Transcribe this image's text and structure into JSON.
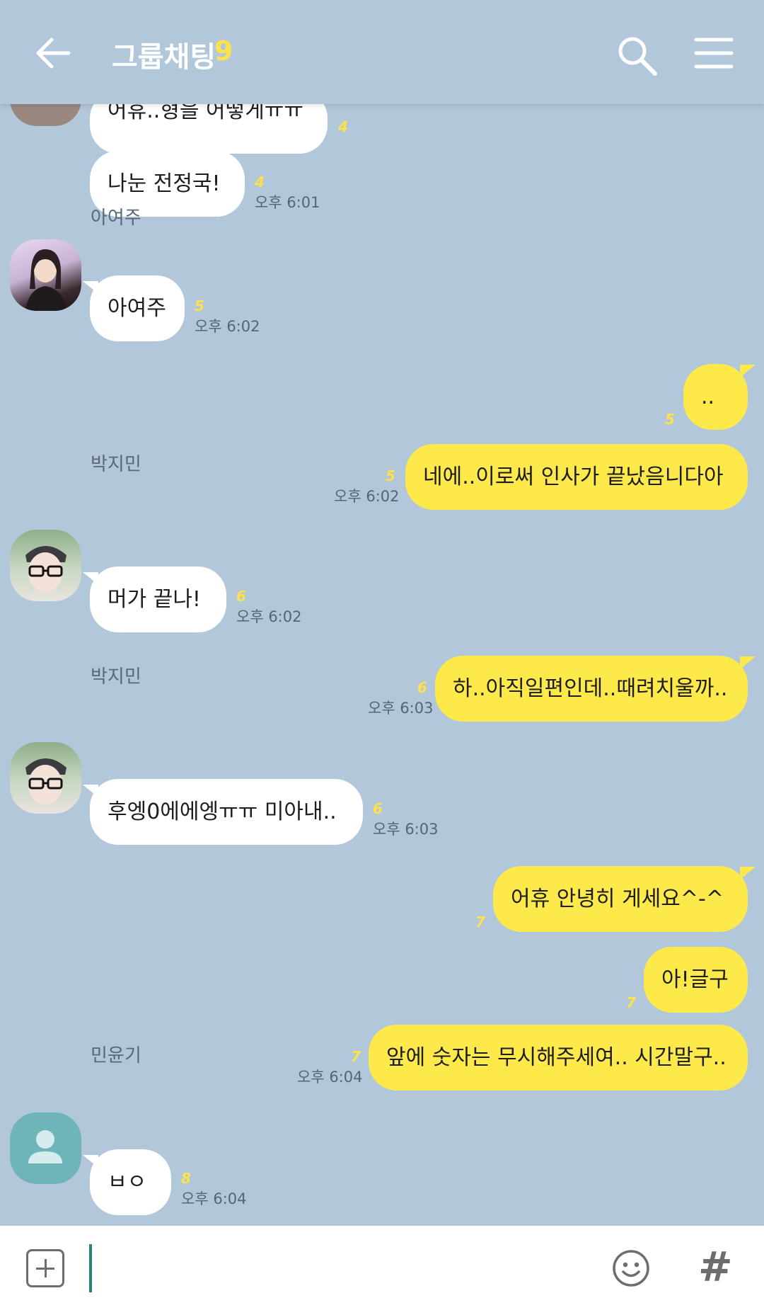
{
  "header": {
    "title": "그룹채팅",
    "count": "9"
  },
  "messages": [
    {
      "text": "어휴..형을 어떻게ㅠㅠ",
      "unread": "4",
      "time": ""
    },
    {
      "text": "나눈 전정국!",
      "unread": "4",
      "time": "오후 6:01"
    },
    {
      "sender": "아여주",
      "text": "아여주",
      "unread": "5",
      "time": "오후 6:02"
    },
    {
      "text": "..",
      "unread": "5",
      "time": ""
    },
    {
      "text": "네에..이로써 인사가 끝났음니다아",
      "unread": "5",
      "time": "오후 6:02"
    },
    {
      "sender": "박지민",
      "text": "머가 끝나!",
      "unread": "6",
      "time": "오후 6:02"
    },
    {
      "text": "하..아직일편인데..때려치울까..",
      "unread": "6",
      "time": "오후 6:03"
    },
    {
      "sender": "박지민",
      "text": "후엥0에에엥ㅠㅠ 미아내..",
      "unread": "6",
      "time": "오후 6:03"
    },
    {
      "text": "어휴 안녕히 게세요^-^",
      "unread": "7",
      "time": ""
    },
    {
      "text": "아!글구",
      "unread": "7",
      "time": ""
    },
    {
      "text": "앞에 숫자는 무시해주세여.. 시간말구..",
      "unread": "7",
      "time": "오후 6:04"
    },
    {
      "sender": "민윤기",
      "text": "ㅂㅇ",
      "unread": "8",
      "time": "오후 6:04"
    }
  ],
  "input": {
    "placeholder": ""
  },
  "colors": {
    "background": "#b2c7da",
    "my_bubble": "#fee94a",
    "their_bubble": "#ffffff",
    "unread_count": "#ffe14a"
  },
  "icons": [
    "back-arrow-icon",
    "search-icon",
    "menu-icon",
    "avatar-photo",
    "default-avatar-icon",
    "plus-icon",
    "emoji-icon",
    "hash-icon"
  ]
}
